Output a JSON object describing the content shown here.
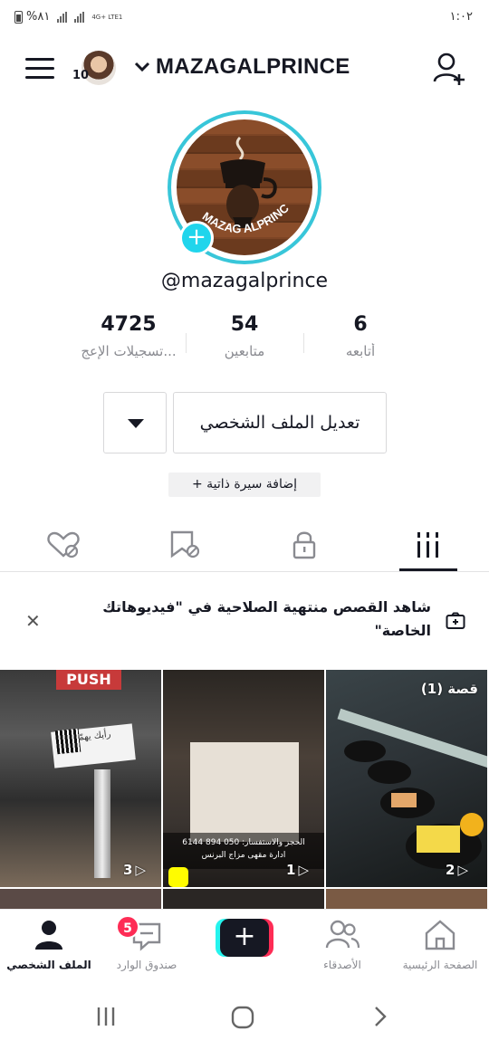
{
  "status": {
    "battery": "%٨١",
    "network": "4G+ LTE1",
    "time": "١:٠٢"
  },
  "header": {
    "notification_count": "10",
    "account_name": "MAZAGALPRINCE"
  },
  "profile": {
    "logo_text": "MAZAG ALPRINCE",
    "handle": "@mazagalprince",
    "stats": [
      {
        "value": "4725",
        "label": "تسجيلات الإعج..."
      },
      {
        "value": "54",
        "label": "متابعين"
      },
      {
        "value": "6",
        "label": "أتابعه"
      }
    ],
    "edit_label": "تعديل الملف الشخصي",
    "bio_label": "+ إضافة سيرة ذاتية"
  },
  "tabs": [
    "liked-videos",
    "favorites",
    "private-videos",
    "videos-grid"
  ],
  "banner": {
    "text": "شاهد القصص منتهية الصلاحية في \"فيديوهاتك الخاصة\""
  },
  "videos": [
    {
      "count": "3",
      "overlay": "PUSH",
      "sign": "رأيك يهمّنا"
    },
    {
      "count": "1",
      "caption": "الحجز والاستفسار: 050 894 6144",
      "caption2": "ادارة مقهى مزاج البرنس"
    },
    {
      "count": "2",
      "story": "قصة (1)"
    }
  ],
  "bottom_nav": {
    "home": "الصفحة الرئيسية",
    "friends": "الأصدقاء",
    "inbox": "صندوق الوارد",
    "inbox_badge": "5",
    "profile": "الملف الشخصي"
  },
  "colors": {
    "accent_cyan": "#20d5ec",
    "accent_red": "#fe2c55",
    "text": "#161823"
  }
}
